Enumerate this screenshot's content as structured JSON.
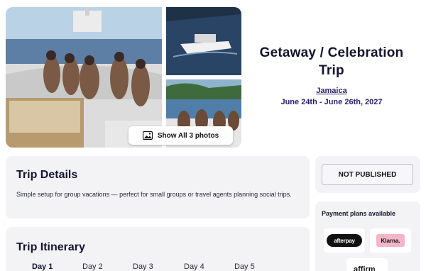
{
  "gallery": {
    "show_all_label": "Show All 3 photos",
    "icons": {
      "show_all": "image-icon"
    }
  },
  "trip": {
    "title": "Getaway / Celebration Trip",
    "location": "Jamaica",
    "dates": "June 24th - June 26th, 2027"
  },
  "trip_details": {
    "heading": "Trip Details",
    "description": "Simple setup for group vacations — perfect for small groups or travel agents planning social trips."
  },
  "itinerary": {
    "heading": "Trip Itinerary",
    "days": [
      "Day 1",
      "Day 2",
      "Day 3",
      "Day 4",
      "Day 5"
    ],
    "active_day": "Day 1"
  },
  "status": {
    "label": "NOT PUBLISHED"
  },
  "payment": {
    "heading": "Payment plans available",
    "providers": [
      {
        "name": "afterpay",
        "label": "afterpay"
      },
      {
        "name": "klarna",
        "label": "Klarna."
      },
      {
        "name": "affirm",
        "label": "affirm"
      }
    ]
  },
  "colors": {
    "heading": "#14142e",
    "accent": "#2b1f6b",
    "card_bg": "#f3f3f6",
    "klarna_pink": "#f4b6c7"
  }
}
